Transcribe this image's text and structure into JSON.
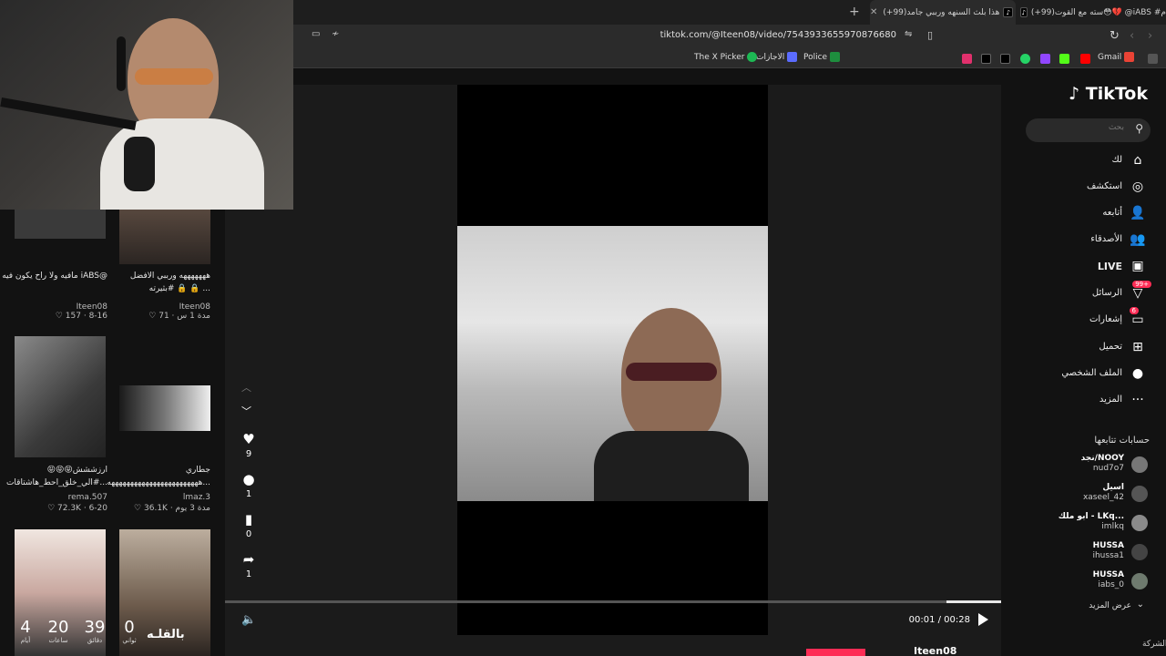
{
  "tabs": [
    {
      "label": "(+99)هذا بلث السنهه ورببي جامد",
      "active": true
    },
    {
      "label": "(+99)سته مع القوت😳💔 @iABS #م",
      "active": false
    }
  ],
  "address": {
    "url": "tiktok.com/@Iteen08/video/7543933655970876680"
  },
  "bookmarks": [
    {
      "label": "Gmail",
      "color": "#ea4335"
    },
    {
      "label": "Police",
      "color": "#1e8e3e"
    },
    {
      "label": "الاجازات",
      "color": "#5b6cff"
    },
    {
      "label": "The X Picker",
      "color": "#1db954"
    }
  ],
  "grid": {
    "items": [
      {
        "caption": "هههههههه ورببي الافضل #بثيرته 🔒 🔒 ...",
        "author": "Iteen08",
        "likes": "71",
        "age": "مدة 1 س"
      },
      {
        "caption": "مافيه ولا راح يكون فيه iABS@",
        "author": "Iteen08",
        "likes": "157",
        "age": "8-16"
      },
      {
        "caption": "جطاري ههههههههههههههههههههههههه...",
        "author": "lmaz.3",
        "likes": "36.1K",
        "age": "مدة 3 يوم"
      },
      {
        "caption": "ارزششش😝😝😝 #الي_خلق_احط_هاشتاقات...",
        "author": "rema.507",
        "likes": "72.3K",
        "age": "6-20"
      }
    ],
    "countdown": [
      {
        "value": "0",
        "unit": "ثواني"
      },
      {
        "value": "39",
        "unit": "دقائق"
      },
      {
        "value": "20",
        "unit": "ساعات"
      },
      {
        "value": "4",
        "unit": "أيام"
      }
    ],
    "thumb_label": "بالقلـه"
  },
  "player": {
    "time": "00:01 / 00:28",
    "progress": 0.04,
    "likes": "9",
    "comments": "1",
    "saves": "0",
    "shares": "1"
  },
  "sidebar": {
    "logo": "TikTok",
    "search_placeholder": "بحث",
    "nav": [
      {
        "label": "لك",
        "icon": "home-icon"
      },
      {
        "label": "استكشف",
        "icon": "explore-icon"
      },
      {
        "label": "أتابعه",
        "icon": "following-icon"
      },
      {
        "label": "الأصدقاء",
        "icon": "friends-icon"
      },
      {
        "label": "LIVE",
        "icon": "live-icon"
      },
      {
        "label": "الرسائل",
        "icon": "messages-icon",
        "badge": "99+"
      },
      {
        "label": "إشعارات",
        "icon": "activity-icon",
        "badge": "6"
      },
      {
        "label": "تحميل",
        "icon": "upload-icon"
      },
      {
        "label": "الملف الشخصي",
        "icon": "profile-icon"
      },
      {
        "label": "المزيد",
        "icon": "more-icon"
      }
    ],
    "following_title": "حسابات تتابعها",
    "following": [
      {
        "name": "نجد/NOOY",
        "handle": "nud7o7"
      },
      {
        "name": "اسيل",
        "handle": "xaseel_42"
      },
      {
        "name": "ابو ملك - LKq...",
        "handle": "imlkq"
      },
      {
        "name": "HUSSA",
        "handle": "ihussa1"
      },
      {
        "name": "HUSSA",
        "handle": "iabs_0"
      }
    ],
    "show_more": "عرض المزيد",
    "company": "الشركة"
  },
  "bottom": {
    "name": "Iteen08"
  }
}
